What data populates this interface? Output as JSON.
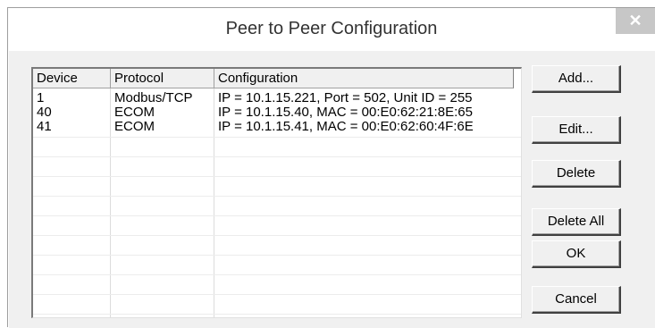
{
  "window": {
    "title": "Peer to Peer Configuration",
    "close_glyph": "✕"
  },
  "table": {
    "columns": [
      "Device",
      "Protocol",
      "Configuration"
    ],
    "rows": [
      {
        "device": "1",
        "protocol": "Modbus/TCP",
        "configuration": "IP = 10.1.15.221, Port = 502, Unit ID = 255"
      },
      {
        "device": "40",
        "protocol": "ECOM",
        "configuration": "IP = 10.1.15.40, MAC = 00:E0:62:21:8E:65"
      },
      {
        "device": "41",
        "protocol": "ECOM",
        "configuration": "IP = 10.1.15.41, MAC = 00:E0:62:60:4F:6E"
      }
    ]
  },
  "buttons": {
    "add": "Add...",
    "edit": "Edit...",
    "delete": "Delete",
    "delete_all": "Delete All",
    "ok": "OK",
    "cancel": "Cancel"
  }
}
